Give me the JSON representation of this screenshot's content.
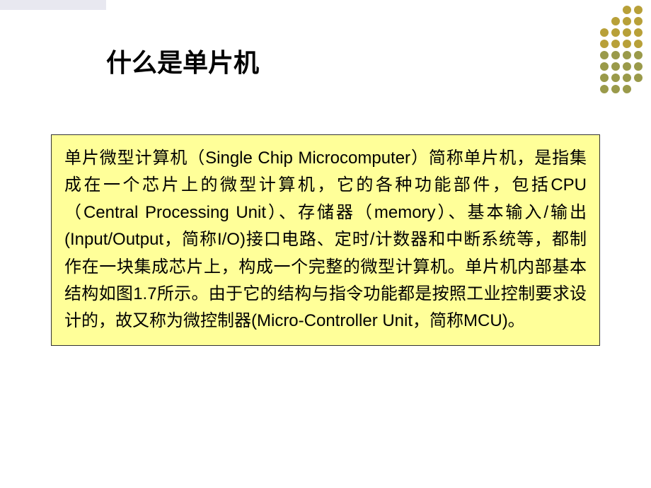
{
  "title": "什么是单片机",
  "body": "单片微型计算机（Single Chip Microcomputer）简称单片机，是指集成在一个芯片上的微型计算机，它的各种功能部件，包括CPU（Central Processing Unit）、存储器（memory）、基本输入/输出(Input/Output，简称I/O)接口电路、定时/计数器和中断系统等，都制作在一块集成芯片上，构成一个完整的微型计算机。单片机内部基本结构如图1.7所示。由于它的结构与指令功能都是按照工业控制要求设计的，故又称为微控制器(Micro-Controller Unit，简称MCU)。"
}
